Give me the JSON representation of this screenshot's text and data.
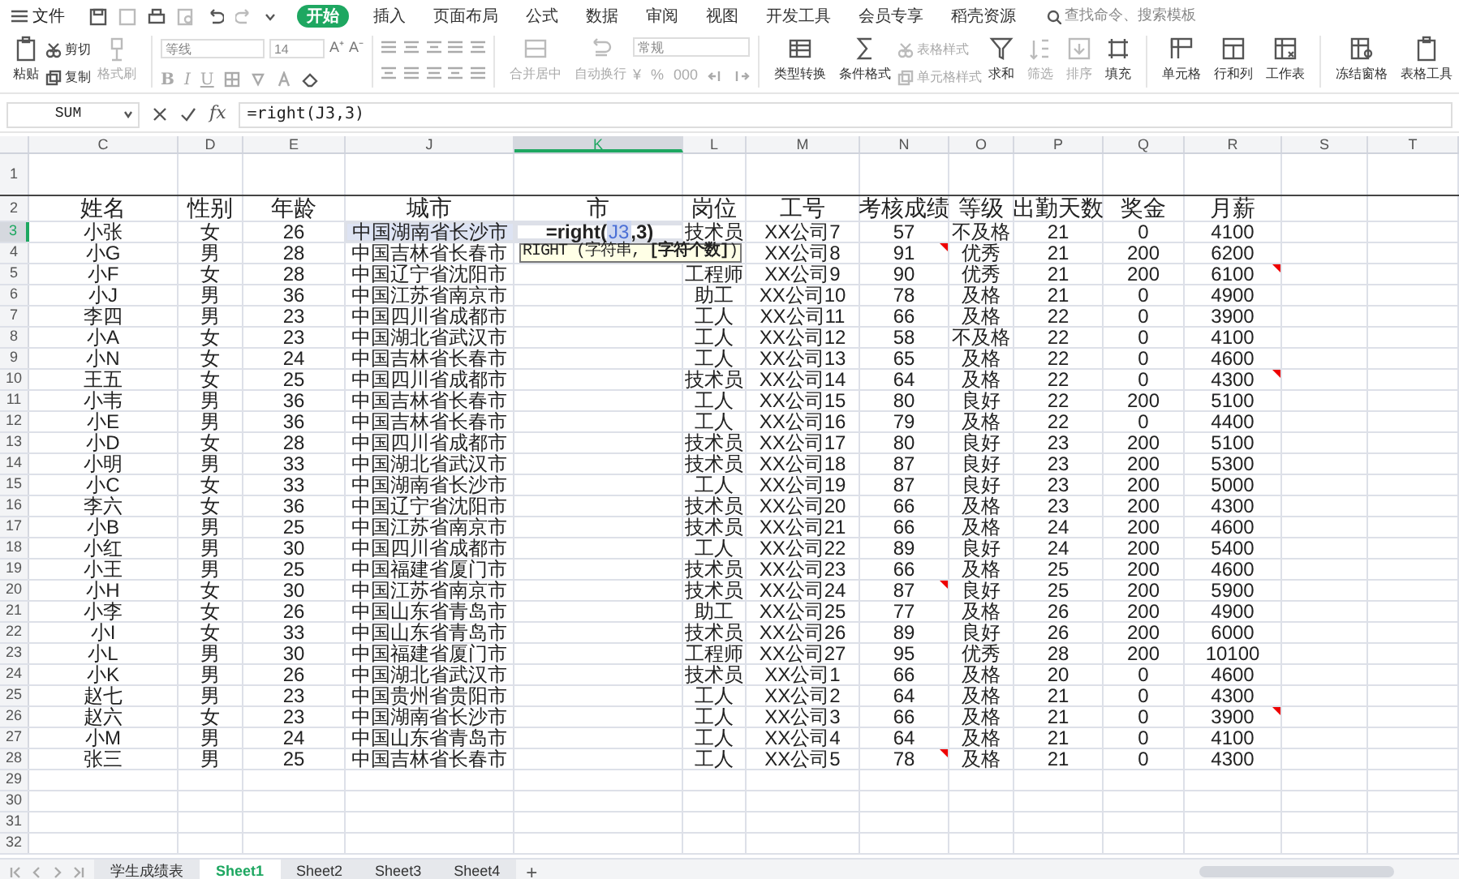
{
  "menu": {
    "file": "文件",
    "tabs": [
      {
        "label": "开始",
        "selected": true
      },
      {
        "label": "插入",
        "selected": false
      },
      {
        "label": "页面布局",
        "selected": false
      },
      {
        "label": "公式",
        "selected": false
      },
      {
        "label": "数据",
        "selected": false
      },
      {
        "label": "审阅",
        "selected": false
      },
      {
        "label": "视图",
        "selected": false
      },
      {
        "label": "开发工具",
        "selected": false
      },
      {
        "label": "会员专享",
        "selected": false
      },
      {
        "label": "稻壳资源",
        "selected": false
      }
    ],
    "search": {
      "placeholder": "查找命令、搜索模板"
    }
  },
  "ribbon": {
    "groups": [
      {
        "kind": "large",
        "label": "粘贴",
        "disabled": false
      },
      {
        "kind": "stack",
        "items": [
          {
            "label": "剪切",
            "disabled": false
          },
          {
            "label": "复制",
            "disabled": false
          }
        ]
      },
      {
        "kind": "large",
        "label": "格式刷",
        "disabled": true
      },
      {
        "kind": "font",
        "font": "等线",
        "size": "14",
        "grow": [
          "A⁺",
          "A⁻"
        ],
        "styles": [
          "B",
          "I",
          "U"
        ]
      },
      {
        "kind": "align"
      },
      {
        "kind": "large",
        "label": "合并居中",
        "disabled": true
      },
      {
        "kind": "large",
        "label": "自动换行",
        "disabled": true
      },
      {
        "kind": "number",
        "format": "常规",
        "buttons": [
          "¥",
          "%",
          "000"
        ]
      },
      {
        "kind": "large",
        "label": "类型转换",
        "disabled": false
      },
      {
        "kind": "large",
        "label": "条件格式",
        "disabled": false
      },
      {
        "kind": "stack",
        "items": [
          {
            "label": "表格样式",
            "disabled": true
          },
          {
            "label": "单元格样式",
            "disabled": true
          }
        ]
      },
      {
        "kind": "large",
        "label": "求和",
        "disabled": false
      },
      {
        "kind": "large",
        "label": "筛选",
        "disabled": true
      },
      {
        "kind": "large",
        "label": "排序",
        "disabled": true
      },
      {
        "kind": "large",
        "label": "填充",
        "disabled": false
      },
      {
        "kind": "large",
        "label": "单元格",
        "disabled": false
      },
      {
        "kind": "large",
        "label": "行和列",
        "disabled": false
      },
      {
        "kind": "large",
        "label": "工作表",
        "disabled": false
      },
      {
        "kind": "large",
        "label": "冻结窗格",
        "disabled": false
      },
      {
        "kind": "large",
        "label": "表格工具",
        "disabled": false
      }
    ]
  },
  "formula_bar": {
    "name_box": "SUM",
    "fx": "fx",
    "formula": "=right(J3,3)"
  },
  "sheet": {
    "columns": [
      {
        "label": "C",
        "selected": false
      },
      {
        "label": "D",
        "selected": false
      },
      {
        "label": "E",
        "selected": false
      },
      {
        "label": "J",
        "selected": false
      },
      {
        "label": "K",
        "selected": true
      },
      {
        "label": "L",
        "selected": false
      },
      {
        "label": "M",
        "selected": false
      },
      {
        "label": "N",
        "selected": false
      },
      {
        "label": "O",
        "selected": false
      },
      {
        "label": "P",
        "selected": false
      },
      {
        "label": "Q",
        "selected": false
      },
      {
        "label": "R",
        "selected": false
      },
      {
        "label": "S",
        "selected": false
      },
      {
        "label": "T",
        "selected": false
      }
    ],
    "headers": [
      "姓名",
      "性别",
      "年龄",
      "城市",
      "市",
      "岗位",
      "工号",
      "考核成绩",
      "等级",
      "出勤天数",
      "奖金",
      "月薪"
    ],
    "editing": {
      "before": "=right(",
      "ref": "J3",
      "after": ",3)",
      "tooltip": "RIGHT (字符串, **[字符个数]**)"
    },
    "rows": [
      {
        "name": "小张",
        "gender": "女",
        "age": "26",
        "city": "中国湖南省长沙市",
        "position": "技术员",
        "emp_id": "XX公司7",
        "score": "57",
        "grade": "不及格",
        "attendance": "21",
        "bonus": "0",
        "salary": "4100",
        "referenced": true,
        "score_note": false,
        "salary_note": false
      },
      {
        "name": "小G",
        "gender": "男",
        "age": "28",
        "city": "中国吉林省长春市",
        "emp_id": "XX公司8",
        "score": "91",
        "grade": "优秀",
        "attendance": "21",
        "bonus": "200",
        "salary": "6200",
        "referenced": false,
        "score_note": true,
        "salary_note": false
      },
      {
        "name": "小F",
        "gender": "女",
        "age": "28",
        "city": "中国辽宁省沈阳市",
        "position": "工程师",
        "emp_id": "XX公司9",
        "score": "90",
        "grade": "优秀",
        "attendance": "21",
        "bonus": "200",
        "salary": "6100",
        "referenced": false,
        "score_note": false,
        "salary_note": true
      },
      {
        "name": "小J",
        "gender": "男",
        "age": "36",
        "city": "中国江苏省南京市",
        "position": "助工",
        "emp_id": "XX公司10",
        "score": "78",
        "grade": "及格",
        "attendance": "21",
        "bonus": "0",
        "salary": "4900",
        "referenced": false,
        "score_note": false,
        "salary_note": false
      },
      {
        "name": "李四",
        "gender": "男",
        "age": "23",
        "city": "中国四川省成都市",
        "position": "工人",
        "emp_id": "XX公司11",
        "score": "66",
        "grade": "及格",
        "attendance": "22",
        "bonus": "0",
        "salary": "3900",
        "referenced": false,
        "score_note": false,
        "salary_note": false
      },
      {
        "name": "小A",
        "gender": "女",
        "age": "23",
        "city": "中国湖北省武汉市",
        "position": "工人",
        "emp_id": "XX公司12",
        "score": "58",
        "grade": "不及格",
        "attendance": "22",
        "bonus": "0",
        "salary": "4100",
        "referenced": false,
        "score_note": false,
        "salary_note": false
      },
      {
        "name": "小N",
        "gender": "女",
        "age": "24",
        "city": "中国吉林省长春市",
        "position": "工人",
        "emp_id": "XX公司13",
        "score": "65",
        "grade": "及格",
        "attendance": "22",
        "bonus": "0",
        "salary": "4600",
        "referenced": false,
        "score_note": false,
        "salary_note": false
      },
      {
        "name": "王五",
        "gender": "女",
        "age": "25",
        "city": "中国四川省成都市",
        "position": "技术员",
        "emp_id": "XX公司14",
        "score": "64",
        "grade": "及格",
        "attendance": "22",
        "bonus": "0",
        "salary": "4300",
        "referenced": false,
        "score_note": false,
        "salary_note": true
      },
      {
        "name": "小韦",
        "gender": "男",
        "age": "36",
        "city": "中国吉林省长春市",
        "position": "工人",
        "emp_id": "XX公司15",
        "score": "80",
        "grade": "良好",
        "attendance": "22",
        "bonus": "200",
        "salary": "5100",
        "referenced": false,
        "score_note": false,
        "salary_note": false
      },
      {
        "name": "小E",
        "gender": "男",
        "age": "36",
        "city": "中国吉林省长春市",
        "position": "工人",
        "emp_id": "XX公司16",
        "score": "79",
        "grade": "及格",
        "attendance": "22",
        "bonus": "0",
        "salary": "4400",
        "referenced": false,
        "score_note": false,
        "salary_note": false
      },
      {
        "name": "小D",
        "gender": "女",
        "age": "28",
        "city": "中国四川省成都市",
        "position": "技术员",
        "emp_id": "XX公司17",
        "score": "80",
        "grade": "良好",
        "attendance": "23",
        "bonus": "200",
        "salary": "5100",
        "referenced": false,
        "score_note": false,
        "salary_note": false
      },
      {
        "name": "小明",
        "gender": "男",
        "age": "33",
        "city": "中国湖北省武汉市",
        "position": "技术员",
        "emp_id": "XX公司18",
        "score": "87",
        "grade": "良好",
        "attendance": "23",
        "bonus": "200",
        "salary": "5300",
        "referenced": false,
        "score_note": false,
        "salary_note": false
      },
      {
        "name": "小C",
        "gender": "女",
        "age": "33",
        "city": "中国湖南省长沙市",
        "position": "工人",
        "emp_id": "XX公司19",
        "score": "87",
        "grade": "良好",
        "attendance": "23",
        "bonus": "200",
        "salary": "5000",
        "referenced": false,
        "score_note": false,
        "salary_note": false
      },
      {
        "name": "李六",
        "gender": "女",
        "age": "36",
        "city": "中国辽宁省沈阳市",
        "position": "技术员",
        "emp_id": "XX公司20",
        "score": "66",
        "grade": "及格",
        "attendance": "23",
        "bonus": "200",
        "salary": "4300",
        "referenced": false,
        "score_note": false,
        "salary_note": false
      },
      {
        "name": "小B",
        "gender": "男",
        "age": "25",
        "city": "中国江苏省南京市",
        "position": "技术员",
        "emp_id": "XX公司21",
        "score": "66",
        "grade": "及格",
        "attendance": "24",
        "bonus": "200",
        "salary": "4600",
        "referenced": false,
        "score_note": false,
        "salary_note": false
      },
      {
        "name": "小红",
        "gender": "男",
        "age": "30",
        "city": "中国四川省成都市",
        "position": "工人",
        "emp_id": "XX公司22",
        "score": "89",
        "grade": "良好",
        "attendance": "24",
        "bonus": "200",
        "salary": "5400",
        "referenced": false,
        "score_note": false,
        "salary_note": false
      },
      {
        "name": "小王",
        "gender": "男",
        "age": "25",
        "city": "中国福建省厦门市",
        "position": "技术员",
        "emp_id": "XX公司23",
        "score": "66",
        "grade": "及格",
        "attendance": "25",
        "bonus": "200",
        "salary": "4600",
        "referenced": false,
        "score_note": false,
        "salary_note": false
      },
      {
        "name": "小H",
        "gender": "女",
        "age": "30",
        "city": "中国江苏省南京市",
        "position": "技术员",
        "emp_id": "XX公司24",
        "score": "87",
        "grade": "良好",
        "attendance": "25",
        "bonus": "200",
        "salary": "5900",
        "referenced": false,
        "score_note": true,
        "salary_note": false
      },
      {
        "name": "小李",
        "gender": "女",
        "age": "26",
        "city": "中国山东省青岛市",
        "position": "助工",
        "emp_id": "XX公司25",
        "score": "77",
        "grade": "及格",
        "attendance": "26",
        "bonus": "200",
        "salary": "4900",
        "referenced": false,
        "score_note": false,
        "salary_note": false
      },
      {
        "name": "小I",
        "gender": "女",
        "age": "33",
        "city": "中国山东省青岛市",
        "position": "技术员",
        "emp_id": "XX公司26",
        "score": "89",
        "grade": "良好",
        "attendance": "26",
        "bonus": "200",
        "salary": "6000",
        "referenced": false,
        "score_note": false,
        "salary_note": false
      },
      {
        "name": "小L",
        "gender": "男",
        "age": "30",
        "city": "中国福建省厦门市",
        "position": "工程师",
        "emp_id": "XX公司27",
        "score": "95",
        "grade": "优秀",
        "attendance": "28",
        "bonus": "200",
        "salary": "10100",
        "referenced": false,
        "score_note": false,
        "salary_note": false
      },
      {
        "name": "小K",
        "gender": "男",
        "age": "26",
        "city": "中国湖北省武汉市",
        "position": "技术员",
        "emp_id": "XX公司1",
        "score": "66",
        "grade": "及格",
        "attendance": "20",
        "bonus": "0",
        "salary": "4600",
        "referenced": false,
        "score_note": false,
        "salary_note": false
      },
      {
        "name": "赵七",
        "gender": "男",
        "age": "23",
        "city": "中国贵州省贵阳市",
        "position": "工人",
        "emp_id": "XX公司2",
        "score": "64",
        "grade": "及格",
        "attendance": "21",
        "bonus": "0",
        "salary": "4300",
        "referenced": false,
        "score_note": false,
        "salary_note": false
      },
      {
        "name": "赵六",
        "gender": "女",
        "age": "23",
        "city": "中国湖南省长沙市",
        "position": "工人",
        "emp_id": "XX公司3",
        "score": "66",
        "grade": "及格",
        "attendance": "21",
        "bonus": "0",
        "salary": "3900",
        "referenced": false,
        "score_note": false,
        "salary_note": true
      },
      {
        "name": "小M",
        "gender": "男",
        "age": "24",
        "city": "中国山东省青岛市",
        "position": "工人",
        "emp_id": "XX公司4",
        "score": "64",
        "grade": "及格",
        "attendance": "21",
        "bonus": "0",
        "salary": "4100",
        "referenced": false,
        "score_note": false,
        "salary_note": false
      },
      {
        "name": "张三",
        "gender": "男",
        "age": "25",
        "city": "中国吉林省长春市",
        "position": "工人",
        "emp_id": "XX公司5",
        "score": "78",
        "grade": "及格",
        "attendance": "21",
        "bonus": "0",
        "salary": "4300",
        "referenced": false,
        "score_note": true,
        "salary_note": false
      }
    ],
    "row_numbers": [
      {
        "label": "1",
        "selected": false
      },
      {
        "label": "2",
        "selected": false
      },
      {
        "label": "3",
        "selected": true
      },
      {
        "label": "4",
        "selected": false
      },
      {
        "label": "5",
        "selected": false
      },
      {
        "label": "6",
        "selected": false
      },
      {
        "label": "7",
        "selected": false
      },
      {
        "label": "8",
        "selected": false
      },
      {
        "label": "9",
        "selected": false
      },
      {
        "label": "10",
        "selected": false
      },
      {
        "label": "11",
        "selected": false
      },
      {
        "label": "12",
        "selected": false
      },
      {
        "label": "13",
        "selected": false
      },
      {
        "label": "14",
        "selected": false
      },
      {
        "label": "15",
        "selected": false
      },
      {
        "label": "16",
        "selected": false
      },
      {
        "label": "17",
        "selected": false
      },
      {
        "label": "18",
        "selected": false
      },
      {
        "label": "19",
        "selected": false
      },
      {
        "label": "20",
        "selected": false
      },
      {
        "label": "21",
        "selected": false
      },
      {
        "label": "22",
        "selected": false
      },
      {
        "label": "23",
        "selected": false
      },
      {
        "label": "24",
        "selected": false
      },
      {
        "label": "25",
        "selected": false
      },
      {
        "label": "26",
        "selected": false
      },
      {
        "label": "27",
        "selected": false
      },
      {
        "label": "28",
        "selected": false
      },
      {
        "label": "29",
        "selected": false
      },
      {
        "label": "30",
        "selected": false
      },
      {
        "label": "31",
        "selected": false
      },
      {
        "label": "32",
        "selected": false
      }
    ]
  },
  "sheet_tabs": [
    {
      "label": "学生成绩表",
      "selected": false
    },
    {
      "label": "Sheet1",
      "selected": true
    },
    {
      "label": "Sheet2",
      "selected": false
    },
    {
      "label": "Sheet3",
      "selected": false
    },
    {
      "label": "Sheet4",
      "selected": false
    }
  ],
  "add_sheet": "+"
}
